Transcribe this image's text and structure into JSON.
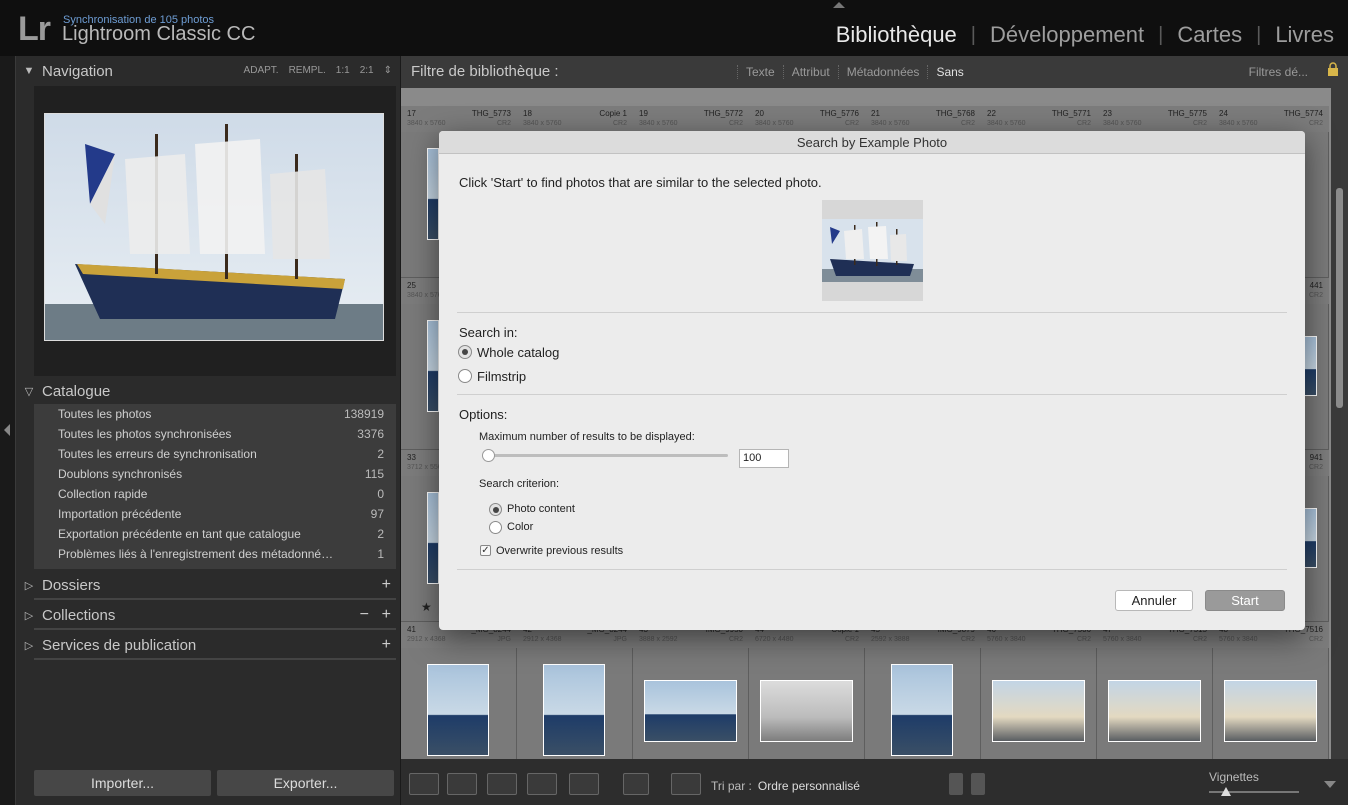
{
  "app": {
    "logo": "Lr",
    "sync_status": "Synchronisation de 105 photos",
    "title": "Lightroom Classic CC"
  },
  "modules": [
    "Bibliothèque",
    "Développement",
    "Cartes",
    "Livres"
  ],
  "active_module": "Bibliothèque",
  "left_panel": {
    "navigation": {
      "label": "Navigation",
      "options": [
        "ADAPT.",
        "REMPL.",
        "1:1",
        "2:1"
      ]
    },
    "catalogue": {
      "label": "Catalogue",
      "items": [
        {
          "label": "Toutes les photos",
          "count": "138919"
        },
        {
          "label": "Toutes les photos synchronisées",
          "count": "3376"
        },
        {
          "label": "Toutes les erreurs de synchronisation",
          "count": "2"
        },
        {
          "label": "Doublons synchronisés",
          "count": "115"
        },
        {
          "label": "Collection rapide",
          "count": "0"
        },
        {
          "label": "Importation précédente",
          "count": "97"
        },
        {
          "label": "Exportation précédente en tant que catalogue",
          "count": "2"
        },
        {
          "label": "Problèmes liés à l'enregistrement des métadonné…",
          "count": "1"
        }
      ]
    },
    "dossiers": "Dossiers",
    "collections": "Collections",
    "services": "Services de publication",
    "import_label": "Importer...",
    "export_label": "Exporter..."
  },
  "filter_bar": {
    "title": "Filtre de bibliothèque :",
    "options": [
      "Texte",
      "Attribut",
      "Métadonnées",
      "Sans"
    ],
    "active": "Sans",
    "preset": "Filtres dé..."
  },
  "grid": {
    "row1": [
      {
        "idx": "17",
        "name": "THG_5773",
        "dim": "3840 x 5760",
        "ext": "CR2"
      },
      {
        "idx": "18",
        "name": "Copie 1",
        "dim": "3840 x 5760",
        "ext": "CR2"
      },
      {
        "idx": "19",
        "name": "THG_5772",
        "dim": "3840 x 5760",
        "ext": "CR2"
      },
      {
        "idx": "20",
        "name": "THG_5776",
        "dim": "3840 x 5760",
        "ext": "CR2"
      },
      {
        "idx": "21",
        "name": "THG_5768",
        "dim": "3840 x 5760",
        "ext": "CR2"
      },
      {
        "idx": "22",
        "name": "THG_5771",
        "dim": "3840 x 5760",
        "ext": "CR2"
      },
      {
        "idx": "23",
        "name": "THG_5775",
        "dim": "3840 x 5760",
        "ext": "CR2"
      },
      {
        "idx": "24",
        "name": "THG_5774",
        "dim": "3840 x 5760",
        "ext": "CR2"
      }
    ],
    "row2_left": {
      "idx": "25",
      "dim": "3840 x 5760"
    },
    "row2_right": {
      "name": "441",
      "ext": "CR2"
    },
    "row3_left": {
      "idx": "33",
      "dim": "3712 x 5568"
    },
    "row3_right": {
      "name": "941",
      "ext": "CR2"
    },
    "row4": [
      {
        "idx": "41",
        "name": "_MG_8244",
        "dim": "2912 x 4368",
        "ext": "JPG"
      },
      {
        "idx": "42",
        "name": "_MG_8244",
        "dim": "2912 x 4368",
        "ext": "JPG"
      },
      {
        "idx": "43",
        "name": "IMG_9950",
        "dim": "3888 x 2592",
        "ext": "CR2"
      },
      {
        "idx": "44",
        "name": "Copie 1",
        "dim": "6720 x 4480",
        "ext": "CR2"
      },
      {
        "idx": "45",
        "name": "IMG_9879",
        "dim": "2592 x 3888",
        "ext": "CR2"
      },
      {
        "idx": "46",
        "name": "THG_7506",
        "dim": "5760 x 3840",
        "ext": "CR2"
      },
      {
        "idx": "47",
        "name": "THG_7515",
        "dim": "5760 x 3840",
        "ext": "CR2"
      },
      {
        "idx": "48",
        "name": "THG_7516",
        "dim": "5760 x 3840",
        "ext": "CR2"
      }
    ]
  },
  "toolbar": {
    "sort_label": "Tri par :",
    "sort_value": "Ordre personnalisé",
    "thumb_label": "Vignettes"
  },
  "dialog": {
    "title": "Search by Example Photo",
    "intro": "Click 'Start' to find photos that are similar to the selected photo.",
    "search_in_label": "Search in:",
    "search_in_options": [
      "Whole catalog",
      "Filmstrip"
    ],
    "search_in_selected": "Whole catalog",
    "options_label": "Options:",
    "max_results_label": "Maximum number of results to be displayed:",
    "max_results_value": "100",
    "criterion_label": "Search criterion:",
    "criterion_options": [
      "Photo content",
      "Color"
    ],
    "criterion_selected": "Photo content",
    "overwrite_label": "Overwrite previous results",
    "overwrite_checked": true,
    "cancel_label": "Annuler",
    "start_label": "Start"
  }
}
